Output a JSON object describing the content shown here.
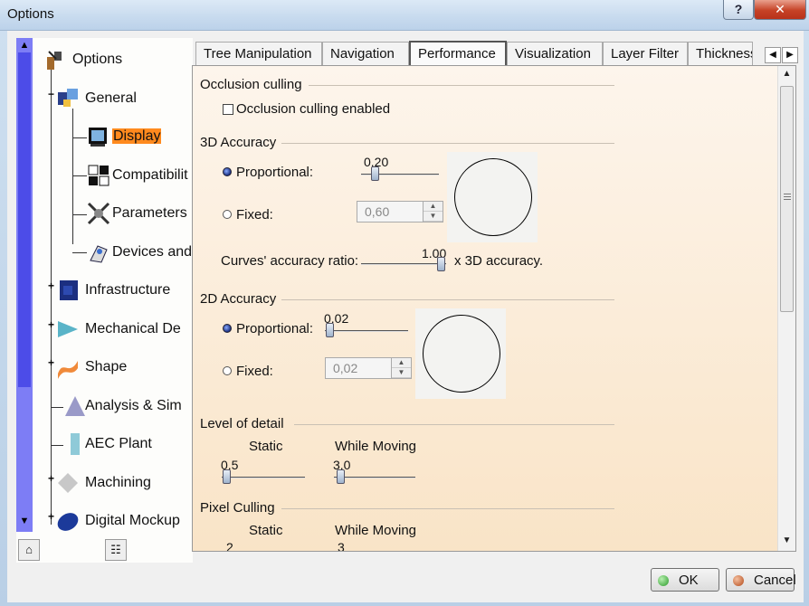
{
  "window": {
    "title": "Options",
    "help_label": "?",
    "close_label": "✕"
  },
  "tree": {
    "items": [
      {
        "label": "Options",
        "icon": "options-icon"
      },
      {
        "label": "General",
        "icon": "general-icon"
      },
      {
        "label": "Display",
        "icon": "display-icon",
        "selected": true
      },
      {
        "label": "Compatibilit",
        "icon": "compatibility-icon"
      },
      {
        "label": "Parameters",
        "icon": "parameters-icon"
      },
      {
        "label": "Devices and",
        "icon": "devices-icon"
      },
      {
        "label": "Infrastructure",
        "icon": "infrastructure-icon"
      },
      {
        "label": "Mechanical De",
        "icon": "mechanical-icon"
      },
      {
        "label": "Shape",
        "icon": "shape-icon"
      },
      {
        "label": "Analysis & Sim",
        "icon": "analysis-icon"
      },
      {
        "label": "AEC Plant",
        "icon": "aec-plant-icon"
      },
      {
        "label": "Machining",
        "icon": "machining-icon"
      },
      {
        "label": "Digital Mockup",
        "icon": "digital-mockup-icon"
      }
    ]
  },
  "tabs": [
    {
      "label": "Tree Manipulation"
    },
    {
      "label": "Navigation"
    },
    {
      "label": "Performance",
      "active": true
    },
    {
      "label": "Visualization"
    },
    {
      "label": "Layer Filter"
    },
    {
      "label": "Thickness"
    }
  ],
  "performance": {
    "occlusion": {
      "title": "Occlusion culling",
      "checkbox_label": "Occlusion culling enabled",
      "checked": false
    },
    "accuracy3d": {
      "title": "3D Accuracy",
      "proportional_label": "Proportional:",
      "proportional_value": "0.20",
      "proportional_selected": true,
      "fixed_label": "Fixed:",
      "fixed_value": "0,60",
      "curves_label": "Curves' accuracy ratio:",
      "curves_value": "1.00",
      "curves_suffix": "x 3D accuracy."
    },
    "accuracy2d": {
      "title": "2D Accuracy",
      "proportional_label": "Proportional:",
      "proportional_value": "0.02",
      "proportional_selected": true,
      "fixed_label": "Fixed:",
      "fixed_value": "0,02"
    },
    "level_of_detail": {
      "title": "Level of detail",
      "static_label": "Static",
      "moving_label": "While Moving",
      "static_value": "0.5",
      "moving_value": "3.0"
    },
    "pixel_culling": {
      "title": "Pixel Culling",
      "static_label": "Static",
      "moving_label": "While Moving",
      "static_value": "2",
      "moving_value": "3"
    }
  },
  "buttons": {
    "ok_label": "OK",
    "cancel_label": "Cancel"
  },
  "colors": {
    "selection": "#ff8a1e",
    "tree_scrollbar": "#7d7df5",
    "panel_bg": "#f9e4c7"
  }
}
